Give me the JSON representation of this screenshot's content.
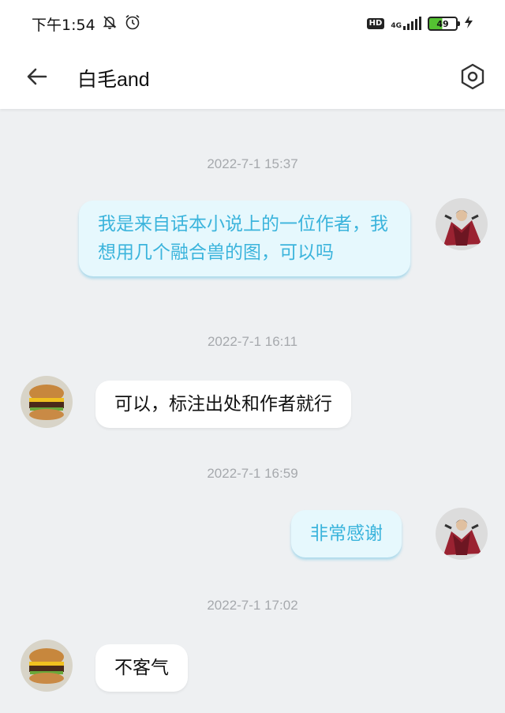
{
  "status_bar": {
    "time": "下午1:54",
    "hd": "HD",
    "network": "4G",
    "battery": "49",
    "battery_level_percent": 49,
    "icons": [
      "bell-off-icon",
      "alarm-icon",
      "signal-icon",
      "battery-icon",
      "charging-icon"
    ]
  },
  "header": {
    "title": "白毛and",
    "back_icon": "arrow-left-icon",
    "settings_icon": "hexagon-settings-icon"
  },
  "messages": [
    {
      "timestamp": "2022-7-1 15:37",
      "side": "right",
      "text": "我是来自话本小说上的一位作者，我想用几个融合兽的图，可以吗"
    },
    {
      "timestamp": "2022-7-1 16:11",
      "side": "left",
      "text": "可以，标注出处和作者就行"
    },
    {
      "timestamp": "2022-7-1 16:59",
      "side": "right",
      "text": "非常感谢"
    },
    {
      "timestamp": "2022-7-1 17:02",
      "side": "left",
      "text": "不客气"
    }
  ],
  "colors": {
    "background": "#eef0f2",
    "out_bubble_bg": "#e6f8fd",
    "out_bubble_text": "#3bb4dc",
    "in_bubble_bg": "#ffffff",
    "timestamp": "#a6a9ad"
  }
}
